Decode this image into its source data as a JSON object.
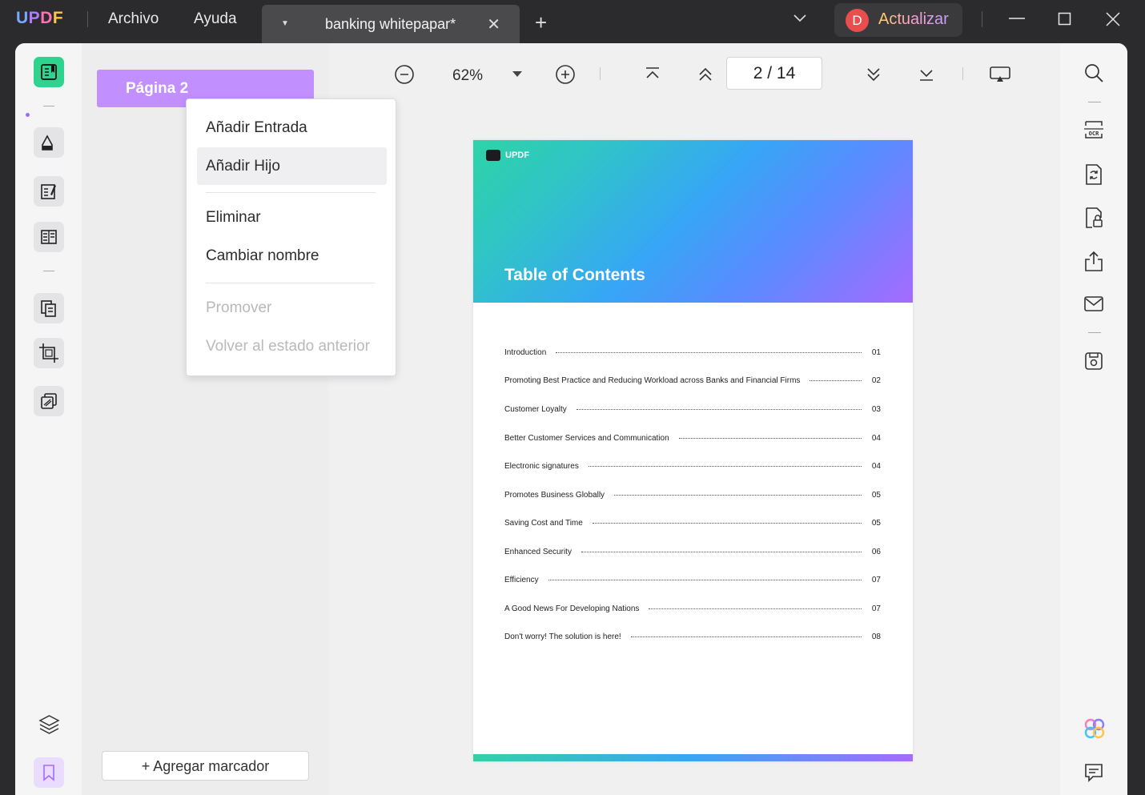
{
  "app": {
    "logo_text": {
      "u": "U",
      "p": "P",
      "d": "D",
      "f": "F"
    },
    "menu": {
      "file": "Archivo",
      "help": "Ayuda"
    },
    "tab": {
      "title": "banking whitepapar*",
      "close_glyph": "✕",
      "add_glyph": "+"
    },
    "upgrade": {
      "avatar_letter": "D",
      "label": "Actualizar"
    }
  },
  "sidebar": {
    "bookmark_item": "Página 2",
    "add_bookmark_label": "+ Agregar marcador"
  },
  "context_menu": {
    "items": [
      "Añadir Entrada",
      "Añadir Hijo",
      "Eliminar",
      "Cambiar nombre",
      "Promover",
      "Volver al estado anterior"
    ]
  },
  "toolbar": {
    "zoom": "62%",
    "page_indicator": "2  /  14"
  },
  "document": {
    "logo_text": "UPDF",
    "title": "Table of Contents",
    "toc": [
      {
        "label": "Introduction",
        "page": "01"
      },
      {
        "label": "Promoting Best Practice and Reducing Workload across Banks and Financial Firms",
        "page": "02"
      },
      {
        "label": "Customer Loyalty",
        "page": "03"
      },
      {
        "label": "Better Customer Services and Communication",
        "page": "04"
      },
      {
        "label": "Electronic signatures",
        "page": "04"
      },
      {
        "label": "Promotes Business Globally",
        "page": "05"
      },
      {
        "label": "Saving Cost and Time",
        "page": "05"
      },
      {
        "label": "Enhanced Security",
        "page": "06"
      },
      {
        "label": "Efficiency",
        "page": "07"
      },
      {
        "label": "A Good News For Developing Nations",
        "page": "07"
      },
      {
        "label": "Don't worry! The solution is here!",
        "page": "08"
      }
    ]
  },
  "icons": {
    "left": [
      "reader-icon",
      "comment-icon",
      "edit-icon",
      "form-icon",
      "organize-icon",
      "crop-icon",
      "protect-icon",
      "layers-icon",
      "bookmark-icon"
    ],
    "right": [
      "search-icon",
      "ocr-icon",
      "convert-icon",
      "protect-file-icon",
      "share-icon",
      "email-icon",
      "save-icon",
      "ai-icon",
      "chat-icon"
    ]
  },
  "colors": {
    "accent_green": "#2fd38f",
    "bookmark_purple": "#c28fff",
    "avatar_red": "#e94d4d"
  }
}
